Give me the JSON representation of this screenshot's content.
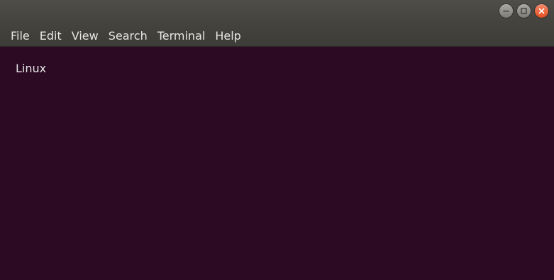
{
  "window": {
    "controls": {
      "minimize_icon": "minimize-icon",
      "maximize_icon": "maximize-icon",
      "close_icon": "close-icon",
      "close_color": "#e95420"
    }
  },
  "menubar": {
    "items": [
      {
        "label": "File"
      },
      {
        "label": "Edit"
      },
      {
        "label": "View"
      },
      {
        "label": "Search"
      },
      {
        "label": "Terminal"
      },
      {
        "label": "Help"
      }
    ]
  },
  "terminal": {
    "background": "#2c0a23",
    "lines": [
      "Linux"
    ]
  }
}
